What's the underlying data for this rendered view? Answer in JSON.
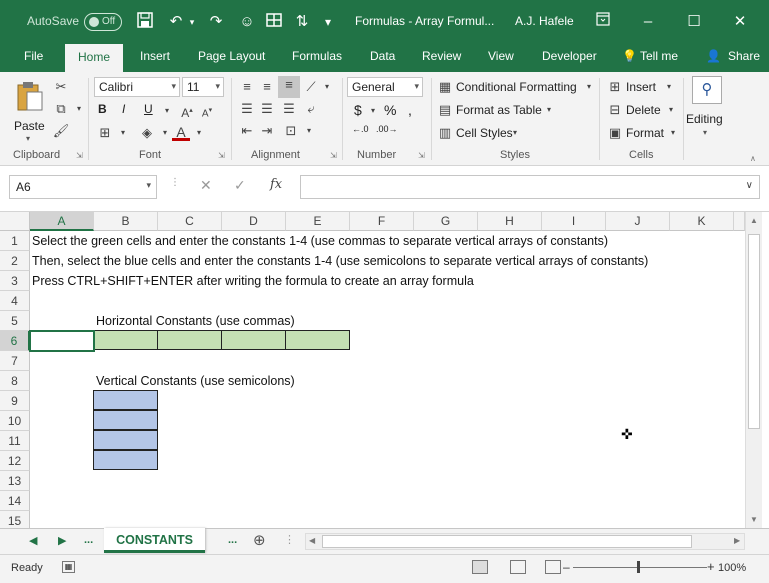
{
  "titlebar": {
    "autosave_label": "AutoSave",
    "autosave_state": "Off",
    "document_title": "Formulas - Array Formul...",
    "user_name": "A.J. Hafele"
  },
  "tabs": [
    "File",
    "Home",
    "Insert",
    "Page Layout",
    "Formulas",
    "Data",
    "Review",
    "Developer"
  ],
  "tell_me": "Tell me",
  "share": "Share",
  "ribbon": {
    "clipboard": {
      "label": "Clipboard",
      "paste": "Paste"
    },
    "font": {
      "label": "Font",
      "font_name": "Calibri",
      "font_size": "11",
      "bold": "B",
      "italic": "I",
      "underline": "U"
    },
    "alignment": {
      "label": "Alignment"
    },
    "number": {
      "label": "Number",
      "format": "General"
    },
    "styles": {
      "label": "Styles",
      "conditional": "Conditional Formatting",
      "format_table": "Format as Table",
      "cell_styles": "Cell Styles"
    },
    "cells": {
      "label": "Cells",
      "insert": "Insert",
      "delete": "Delete",
      "format": "Format"
    },
    "editing": {
      "label": "Editing"
    }
  },
  "formula_bar": {
    "name_box": "A6",
    "formula": ""
  },
  "columns": [
    "A",
    "B",
    "C",
    "D",
    "E",
    "F",
    "G",
    "H",
    "I",
    "J",
    "K"
  ],
  "rows": [
    "1",
    "2",
    "3",
    "4",
    "5",
    "6",
    "7",
    "8",
    "9",
    "10",
    "11",
    "12",
    "13",
    "14",
    "15"
  ],
  "cells": {
    "A1": "Select the green cells and enter the constants 1-4 (use commas to separate vertical arrays of constants)",
    "A2": "Then, select the blue cells and enter the constants 1-4 (use semicolons to separate vertical arrays of constants)",
    "A3": "Press CTRL+SHIFT+ENTER after writing the formula to create an array formula",
    "B5": "Horizontal Constants (use commas)",
    "B8": "Vertical Constants (use semicolons)"
  },
  "sheets": {
    "active": "CONSTANTS",
    "more": "..."
  },
  "status": {
    "ready": "Ready",
    "zoom": "100%"
  },
  "colors": {
    "excel_green": "#217346",
    "green_fill": "#c5e0b3",
    "blue_fill": "#b4c6e7"
  }
}
